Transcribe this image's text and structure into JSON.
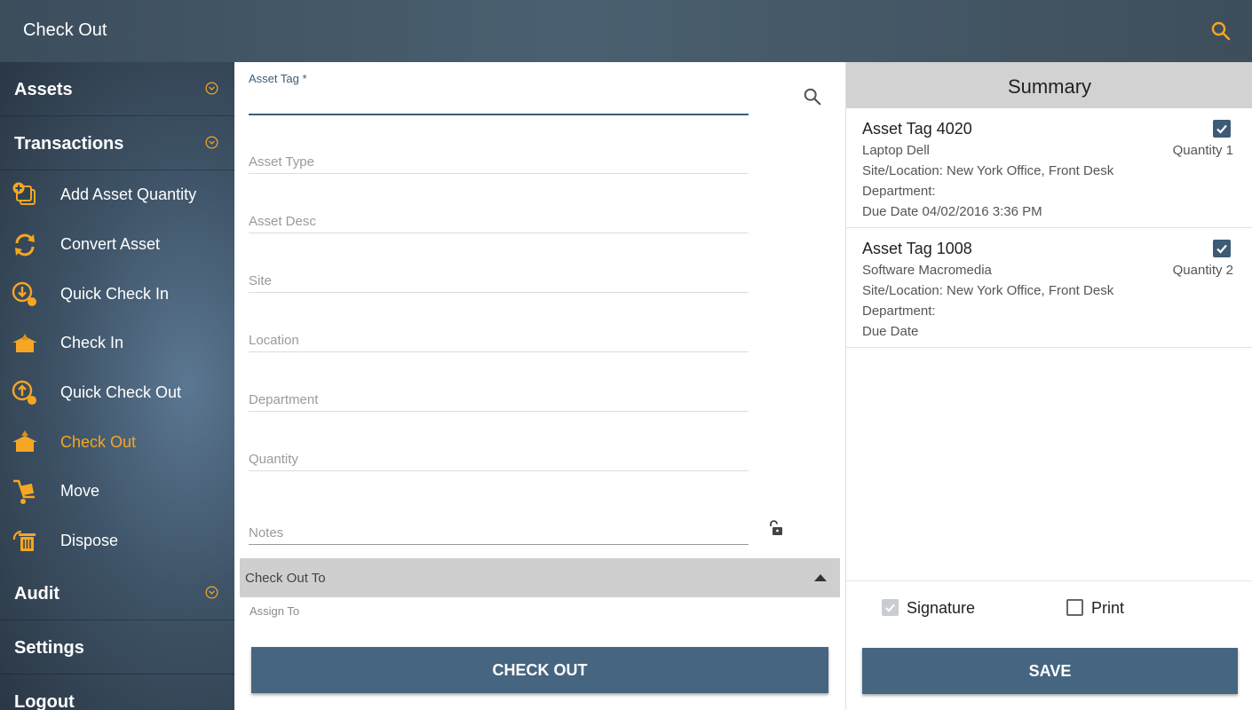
{
  "header": {
    "title": "Check Out",
    "search_icon": "search-icon",
    "accent": "#f5a623"
  },
  "sidebar": {
    "sections": {
      "assets": "Assets",
      "transactions": "Transactions",
      "audit": "Audit",
      "settings": "Settings",
      "logout": "Logout"
    },
    "items": [
      {
        "label": "Add Asset Quantity",
        "icon": "add-asset-quantity-icon"
      },
      {
        "label": "Convert Asset",
        "icon": "convert-asset-icon"
      },
      {
        "label": "Quick Check In",
        "icon": "quick-check-in-icon"
      },
      {
        "label": "Check In",
        "icon": "check-in-icon"
      },
      {
        "label": "Quick Check Out",
        "icon": "quick-check-out-icon"
      },
      {
        "label": "Check Out",
        "icon": "check-out-icon",
        "active": true
      },
      {
        "label": "Move",
        "icon": "move-icon"
      },
      {
        "label": "Dispose",
        "icon": "dispose-icon"
      }
    ]
  },
  "form": {
    "asset_tag_label": "Asset Tag *",
    "asset_tag_value": "",
    "fields": {
      "asset_type": "Asset Type",
      "asset_desc": "Asset Desc",
      "site": "Site",
      "location": "Location",
      "department": "Department",
      "quantity": "Quantity",
      "notes": "Notes"
    },
    "check_out_to": "Check Out To",
    "assign_to": "Assign To",
    "check_out_button": "CHECK OUT"
  },
  "summary": {
    "title": "Summary",
    "entries": [
      {
        "tag": "Asset Tag 4020",
        "type": "Laptop Dell",
        "quantity": "Quantity 1",
        "site": "Site/Location:  New York Office, Front Desk",
        "department": "Department:",
        "due": "Due Date  04/02/2016 3:36 PM",
        "checked": true
      },
      {
        "tag": "Asset Tag 1008",
        "type": "Software Macromedia",
        "quantity": "Quantity 2",
        "site": "Site/Location:  New York Office, Front Desk",
        "department": "Department:",
        "due": "Due Date",
        "checked": true
      }
    ],
    "signature_label": "Signature",
    "signature_checked": true,
    "print_label": "Print",
    "print_checked": false,
    "save_button": "SAVE"
  }
}
